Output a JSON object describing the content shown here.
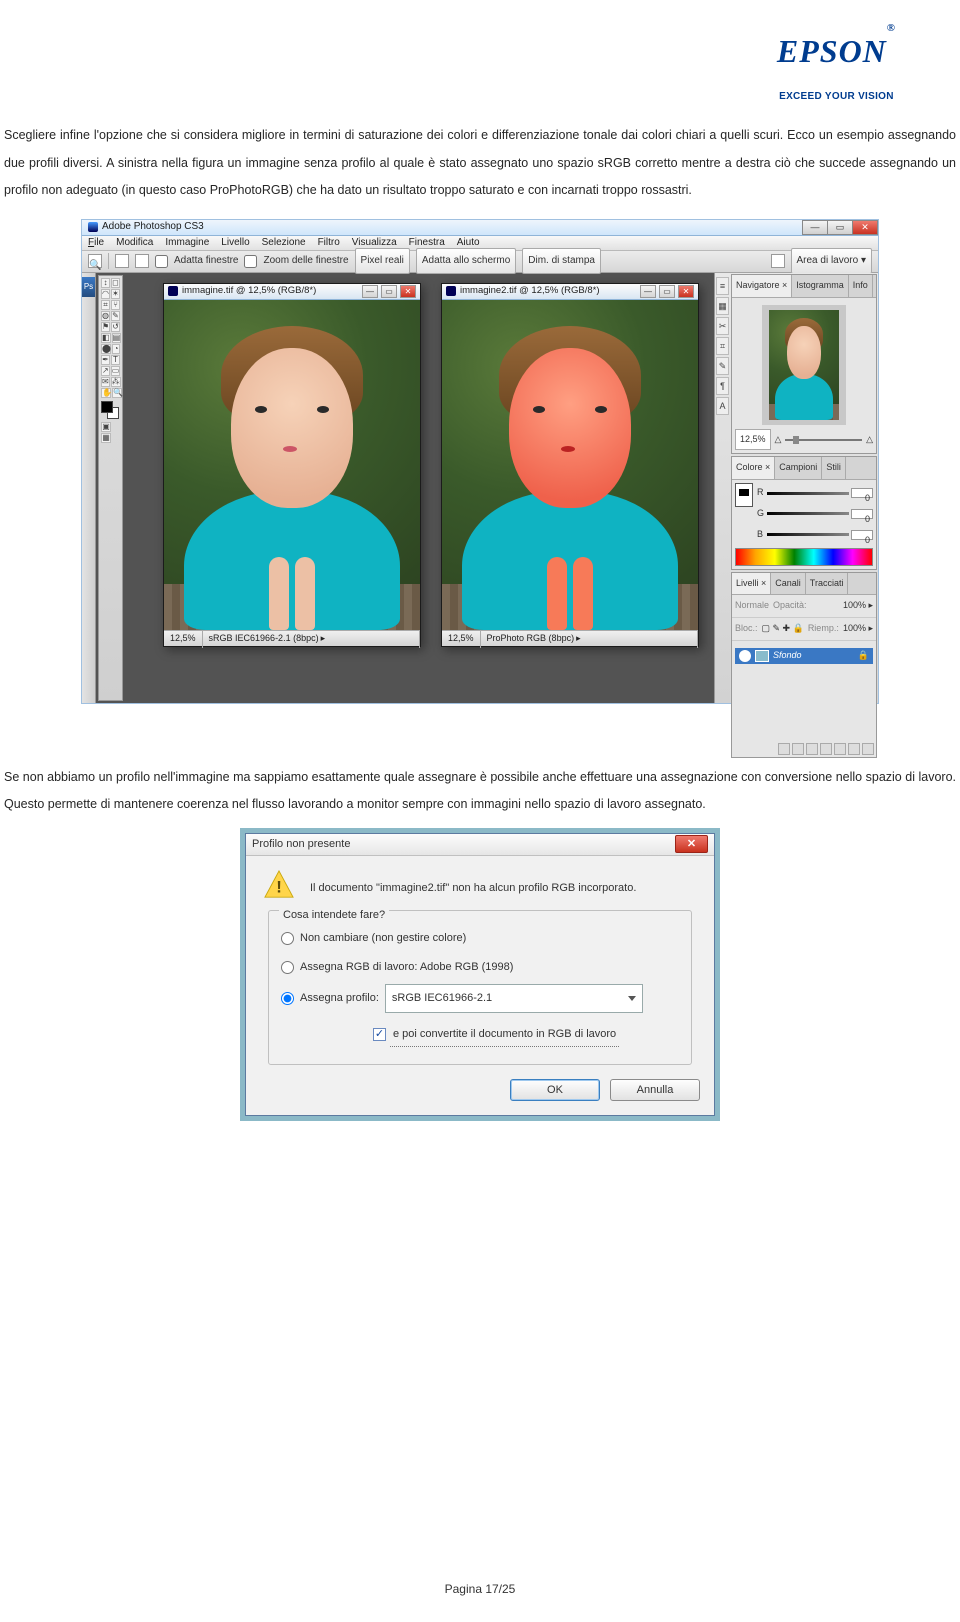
{
  "header": {
    "brand": "EPSON",
    "reg": "®",
    "tagline": "EXCEED YOUR VISION"
  },
  "para1": "Scegliere infine l'opzione che si considera migliore in termini di saturazione dei colori e differenziazione tonale dai colori chiari a quelli scuri. Ecco un esempio assegnando due profili diversi. A sinistra nella figura un immagine senza profilo al quale è stato assegnato uno spazio sRGB corretto mentre a destra ciò che succede assegnando un profilo non adeguato (in questo caso ProPhotoRGB) che ha dato un risultato troppo saturato e con incarnati troppo rossastri.",
  "para2": "Se non abbiamo un profilo nell'immagine ma sappiamo esattamente quale assegnare è possibile anche effettuare una assegnazione con conversione nello spazio di lavoro. Questo permette di mantenere coerenza nel flusso lavorando a monitor sempre con immagini nello spazio di lavoro assegnato.",
  "footer": "Pagina 17/25",
  "ps": {
    "app_title": "Adobe Photoshop CS3",
    "menu": [
      "File",
      "Modifica",
      "Immagine",
      "Livello",
      "Selezione",
      "Filtro",
      "Visualizza",
      "Finestra",
      "Aiuto"
    ],
    "options": {
      "adatta": "Adatta finestre",
      "zoom": "Zoom delle finestre",
      "pixel": "Pixel reali",
      "schermo": "Adatta allo schermo",
      "stampa": "Dim. di stampa",
      "workspace": "Area di lavoro ▾"
    },
    "doc_left": {
      "title": "immagine.tif @ 12,5% (RGB/8*)",
      "zoom": "12,5%",
      "profile": "sRGB IEC61966-2.1 (8bpc)"
    },
    "doc_right": {
      "title": "immagine2.tif @ 12,5% (RGB/8*)",
      "zoom": "12,5%",
      "profile": "ProPhoto RGB (8bpc)"
    },
    "panels": {
      "nav_tabs": [
        "Navigatore ×",
        "Istogramma",
        "Info"
      ],
      "nav_zoom": "12,5%",
      "color_tabs": [
        "Colore ×",
        "Campioni",
        "Stili"
      ],
      "color": {
        "r": "R",
        "g": "G",
        "b": "B",
        "val": "0"
      },
      "layer_tabs": [
        "Livelli ×",
        "Canali",
        "Tracciati"
      ],
      "layer_mode": "Normale",
      "layer_op_label": "Opacità:",
      "layer_op_val": "100% ▸",
      "layer_lock": "Bloc.:",
      "layer_fill_label": "Riemp.:",
      "layer_fill_val": "100% ▸",
      "layer_name": "Sfondo"
    },
    "ps_tab": "Ps"
  },
  "dlg": {
    "title": "Profilo non presente",
    "msg": "Il documento \"immagine2.tif\" non ha alcun profilo RGB incorporato.",
    "legend": "Cosa intendete fare?",
    "opt1": "Non cambiare (non gestire colore)",
    "opt2": "Assegna RGB di lavoro:  Adobe RGB (1998)",
    "opt3_label": "Assegna profilo:",
    "opt3_value": "sRGB IEC61966-2.1",
    "ck": "e poi convertite il documento in RGB di lavoro",
    "ok": "OK",
    "cancel": "Annulla"
  }
}
